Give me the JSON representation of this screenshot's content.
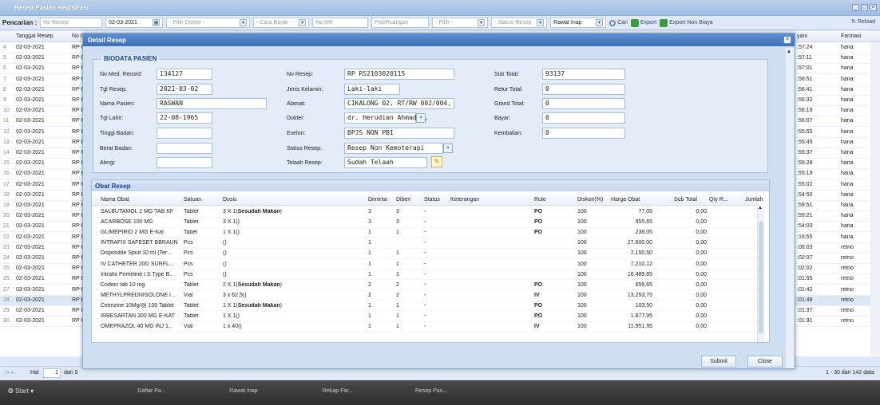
{
  "app": {
    "title": "Resep Pasien Registrasi",
    "reload": "Reload"
  },
  "filters": {
    "label": "Pencarian :",
    "no_resep": "No Resep",
    "date": "02-03-2021",
    "dokter": "- Pilih Dokter -",
    "cara_bayar": "- Cara Bayar -",
    "no_mr": "No MR",
    "poli": "Poli/Ruangan",
    "pilih": "- Pilih -",
    "status": "- Status Resep",
    "rawat": "Rawat Inap",
    "cari": "Cari",
    "export": "Export",
    "export_non": "Export Non Biaya"
  },
  "bg": {
    "headers": {
      "tanggal": "Tanggal Resep",
      "no": "No R",
      "yani": "yani",
      "farmasi": "Farmasi"
    },
    "rows": [
      {
        "n": "4",
        "d": "02-03-2021",
        "no": "RP R",
        "t": ":57:24",
        "f": "hana"
      },
      {
        "n": "5",
        "d": "02-03-2021",
        "no": "RP R",
        "t": ":57:11",
        "f": "hana"
      },
      {
        "n": "6",
        "d": "02-03-2021",
        "no": "RP R",
        "t": ":57:01",
        "f": "hana"
      },
      {
        "n": "7",
        "d": "02-03-2021",
        "no": "RP R",
        "t": ":56:51",
        "f": "hana"
      },
      {
        "n": "8",
        "d": "02-03-2021",
        "no": "RP R",
        "t": ":56:41",
        "f": "hana"
      },
      {
        "n": "9",
        "d": "02-03-2021",
        "no": "RP R",
        "t": ":56:32",
        "f": "hana"
      },
      {
        "n": "10",
        "d": "02-03-2021",
        "no": "RP R",
        "t": ":56:19",
        "f": "hana"
      },
      {
        "n": "11",
        "d": "02-03-2021",
        "no": "RP R",
        "t": ":56:07",
        "f": "hana"
      },
      {
        "n": "12",
        "d": "02-03-2021",
        "no": "RP R",
        "t": ":55:55",
        "f": "hana"
      },
      {
        "n": "13",
        "d": "02-03-2021",
        "no": "RP R",
        "t": ":55:45",
        "f": "hana"
      },
      {
        "n": "14",
        "d": "02-03-2021",
        "no": "RP R",
        "t": ":55:37",
        "f": "hana"
      },
      {
        "n": "15",
        "d": "02-03-2021",
        "no": "RP R",
        "t": ":55:28",
        "f": "hana"
      },
      {
        "n": "16",
        "d": "02-03-2021",
        "no": "RP R",
        "t": ":55:19",
        "f": "hana"
      },
      {
        "n": "17",
        "d": "02-03-2021",
        "no": "RP R",
        "t": ":55:02",
        "f": "hana"
      },
      {
        "n": "18",
        "d": "02-03-2021",
        "no": "RP R",
        "t": ":54:50",
        "f": "hana"
      },
      {
        "n": "19",
        "d": "02-03-2021",
        "no": "RP R",
        "t": ":59:51",
        "f": "hana"
      },
      {
        "n": "20",
        "d": "02-03-2021",
        "no": "RP R",
        "t": ":59:21",
        "f": "hana"
      },
      {
        "n": "21",
        "d": "02-03-2021",
        "no": "RP R",
        "t": ":54:03",
        "f": "hana"
      },
      {
        "n": "22",
        "d": "02-03-2021",
        "no": "RP R",
        "t": ":16:55",
        "f": "hana"
      },
      {
        "n": "23",
        "d": "02-03-2021",
        "no": "RP R",
        "t": ":06:03",
        "f": "retno"
      },
      {
        "n": "24",
        "d": "02-03-2021",
        "no": "RP R",
        "t": ":02:07",
        "f": "retno"
      },
      {
        "n": "25",
        "d": "02-03-2021",
        "no": "RP R",
        "t": ":02:02",
        "f": "retno"
      },
      {
        "n": "26",
        "d": "02-03-2021",
        "no": "RP R",
        "t": ":01:55",
        "f": "retno"
      },
      {
        "n": "27",
        "d": "02-03-2021",
        "no": "RP R",
        "t": ":01:42",
        "f": "retno"
      },
      {
        "n": "28",
        "d": "02-03-2021",
        "no": "RP R",
        "t": ":01:49",
        "f": "retno"
      },
      {
        "n": "29",
        "d": "02-03-2021",
        "no": "RP R",
        "t": ":01:37",
        "f": "retno"
      },
      {
        "n": "30",
        "d": "02-03-2021",
        "no": "RP R",
        "t": ":01:31",
        "f": "retno"
      }
    ]
  },
  "pager": {
    "hal": "Hal",
    "page": "1",
    "dari": "dari 5",
    "count": "1 - 30 dari 142 data"
  },
  "taskbar": {
    "start": "Start",
    "items": [
      "Daftar Pa...",
      "Rawat Inap",
      "Rekap Far...",
      "Resep Pas..."
    ]
  },
  "modal": {
    "title": "Detail Resep",
    "biodata": {
      "legend": "BIODATA PASIEN",
      "no_mr_l": "No Med. Record:",
      "no_mr": "134127",
      "tgl_resep_l": "Tgl Resep:",
      "tgl_resep": "2021-03-02",
      "nama_l": "Nama Pasien:",
      "nama": "RASWAN",
      "tgl_lahir_l": "Tgl Lahir:",
      "tgl_lahir": "22-08-1965",
      "tinggi_l": "Tinggi Badan:",
      "berat_l": "Berat Badan:",
      "alergi_l": "Alergi:",
      "no_resep_l": "No Resep:",
      "no_resep": "RP RS2103020115",
      "jk_l": "Jenis Kelamin:",
      "jk": "Laki-laki",
      "alamat_l": "Alamat:",
      "alamat": "CIKALONG 02, RT/RW 002/004, KE",
      "dokter_l": "Dokter:",
      "dokter": "dr. Herudian Ahmadin,",
      "eselon_l": "Eselon:",
      "eselon": "BPJS NON PBI",
      "status_l": "Status Resep:",
      "status": "Resep Non Kemoterapi",
      "telaah_l": "Telaah Resep:",
      "telaah": "Sudah Telaah",
      "subtotal_l": "Sub Total:",
      "subtotal": "93137",
      "retur_l": "Retur Total:",
      "retur": "0",
      "grand_l": "Grand Total:",
      "grand": "0",
      "bayar_l": "Bayar:",
      "bayar": "0",
      "kembalian_l": "Kembalian:",
      "kembalian": "0"
    },
    "obat": {
      "title": "Obat Resep",
      "headers": {
        "nama": "Nama Obat",
        "satuan": "Satuan",
        "dosis": "Dosis",
        "diminta": "Diminta",
        "diberi": "Diberi",
        "status": "Status",
        "ket": "Keterangan",
        "rute": "Rute",
        "diskon": "Diskon(%)",
        "harga": "Harga Obat",
        "sub": "Sub Total",
        "qty": "Qty R...",
        "jumlah": "Jumlah"
      },
      "rows": [
        {
          "nama": "SALBUTAMOL 2 MG TAB KF",
          "satuan": "Tablet",
          "dosis_a": "3 X 1(",
          "dosis_b": "Sesudah Makan",
          "dosis_c": ")",
          "diminta": "3",
          "diberi": "3",
          "status": "-",
          "rute": "PO",
          "diskon": "100",
          "harga": "77,05",
          "sub": "0,00"
        },
        {
          "nama": "ACARBOSE 100 MG",
          "satuan": "Tablet",
          "dosis_a": "3 X 1()",
          "dosis_b": "",
          "dosis_c": "",
          "diminta": "3",
          "diberi": "3",
          "status": "-",
          "rute": "PO",
          "diskon": "100",
          "harga": "955,65",
          "sub": "0,00"
        },
        {
          "nama": "GLIMEPIRID 2 MG E-Kat",
          "satuan": "Tabet",
          "dosis_a": "1 X 1()",
          "dosis_b": "",
          "dosis_c": "",
          "diminta": "1",
          "diberi": "1",
          "status": "-",
          "rute": "PO",
          "diskon": "100",
          "harga": "238,05",
          "sub": "0,00"
        },
        {
          "nama": "INTRAFIX SAFESET BBRAUN",
          "satuan": "Pcs",
          "dosis_a": "()",
          "dosis_b": "",
          "dosis_c": "",
          "diminta": "1",
          "diberi": "",
          "status": "-",
          "rute": "",
          "diskon": "100",
          "harga": "27.600,00",
          "sub": "0,00"
        },
        {
          "nama": "Disposible Spuit 10 ml (Ter...",
          "satuan": "Pcs",
          "dosis_a": "()",
          "dosis_b": "",
          "dosis_c": "",
          "diminta": "1",
          "diberi": "1",
          "status": "-",
          "rute": "",
          "diskon": "100",
          "harga": "2.150,50",
          "sub": "0,00"
        },
        {
          "nama": "IV CATHETER 20G SURFL...",
          "satuan": "Pcs",
          "dosis_a": "()",
          "dosis_b": "",
          "dosis_c": "",
          "diminta": "1",
          "diberi": "1",
          "status": "-",
          "rute": "",
          "diskon": "100",
          "harga": "7.210,12",
          "sub": "0,00"
        },
        {
          "nama": "Intrafix Primeline I.S Type B...",
          "satuan": "Pcs",
          "dosis_a": "()",
          "dosis_b": "",
          "dosis_c": "",
          "diminta": "1",
          "diberi": "1",
          "status": "-",
          "rute": "",
          "diskon": "100",
          "harga": "16.489,85",
          "sub": "0,00"
        },
        {
          "nama": "Codein tab 10 mg",
          "satuan": "Tablet",
          "dosis_a": "2 X 1(",
          "dosis_b": "Sesudah Makan",
          "dosis_c": ")",
          "diminta": "2",
          "diberi": "2",
          "status": "-",
          "rute": "PO",
          "diskon": "100",
          "harga": "656,65",
          "sub": "0,00"
        },
        {
          "nama": "METHYLPREDNISOLONE I...",
          "satuan": "Vial",
          "dosis_a": "3 x 62,5()",
          "dosis_b": "",
          "dosis_c": "",
          "diminta": "2",
          "diberi": "2",
          "status": "-",
          "rute": "IV",
          "diskon": "100",
          "harga": "13.253,75",
          "sub": "0,00"
        },
        {
          "nama": "Cetirizine 10Mg/@ 100 Tablet",
          "satuan": "Tablet",
          "dosis_a": "1 X 1(",
          "dosis_b": "Sesudah Makan",
          "dosis_c": ")",
          "diminta": "1",
          "diberi": "1",
          "status": "-",
          "rute": "PO",
          "diskon": "100",
          "harga": "103,50",
          "sub": "0,00"
        },
        {
          "nama": "IRBESARTAN 300 MG E-KAT",
          "satuan": "Tablet",
          "dosis_a": "1 X 1()",
          "dosis_b": "",
          "dosis_c": "",
          "diminta": "1",
          "diberi": "1",
          "status": "-",
          "rute": "PO",
          "diskon": "100",
          "harga": "1.877,95",
          "sub": "0,00"
        },
        {
          "nama": "OMEPRAZOL 40 MG INJ 1...",
          "satuan": "Vial",
          "dosis_a": "1 x 40()",
          "dosis_b": "",
          "dosis_c": "",
          "diminta": "1",
          "diberi": "1",
          "status": "-",
          "rute": "IV",
          "diskon": "100",
          "harga": "11.951,95",
          "sub": "0,00"
        }
      ]
    },
    "submit": "Submit",
    "close": "Close"
  }
}
